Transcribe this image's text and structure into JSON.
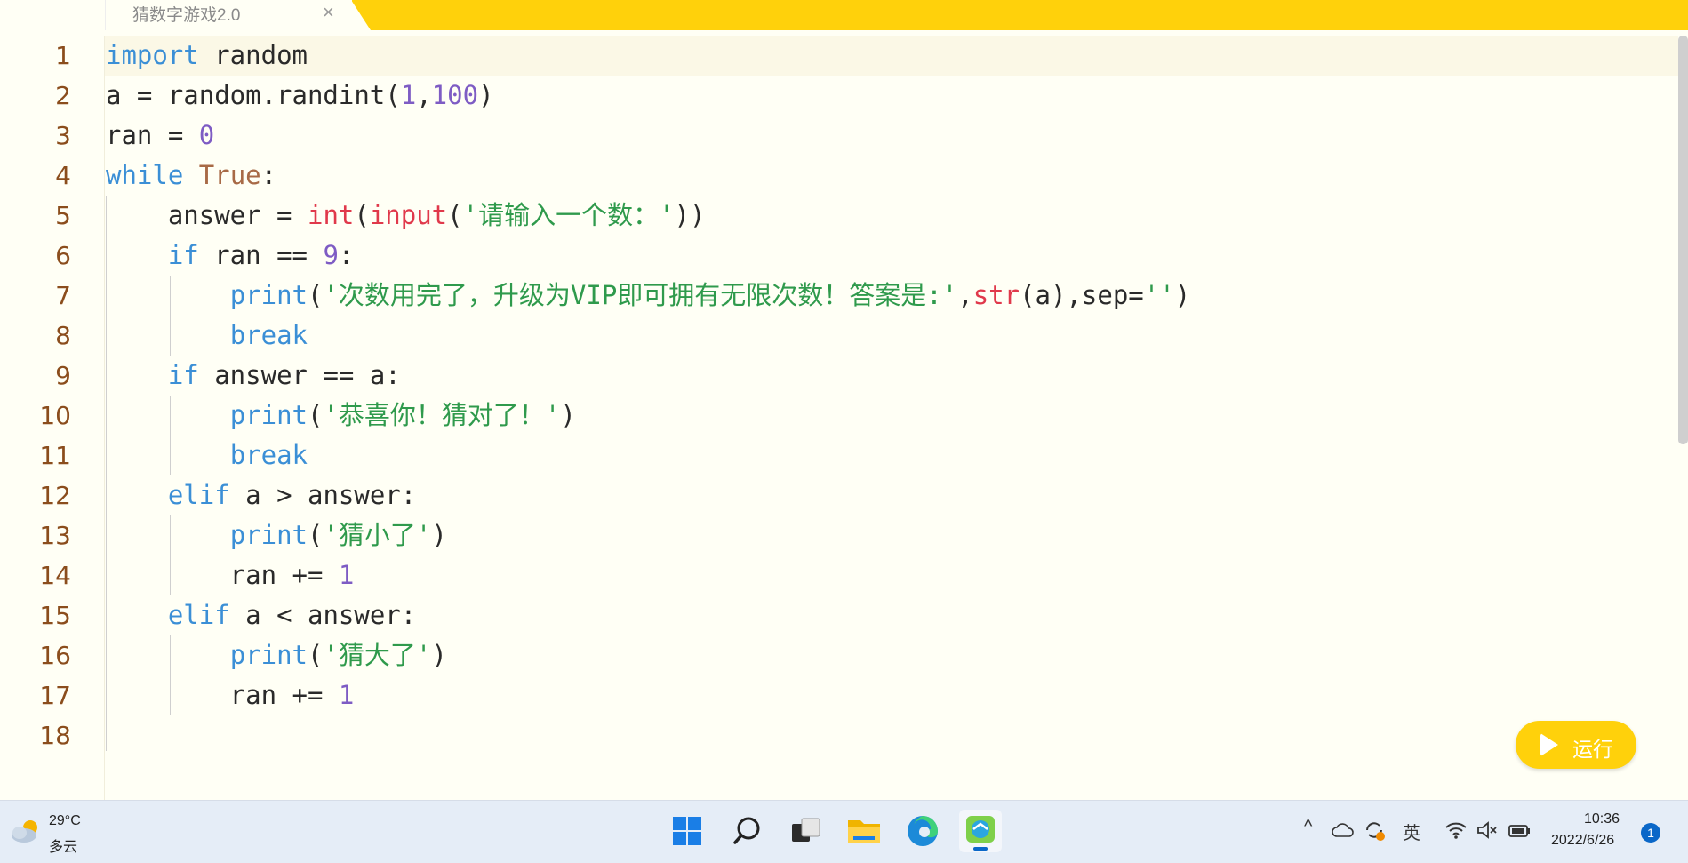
{
  "tab": {
    "title": "猜数字游戏2.0",
    "close_label": "×"
  },
  "editor": {
    "lines": [
      [
        [
          "kw",
          "import"
        ],
        [
          "",
          " random"
        ]
      ],
      [
        [
          "",
          "a = random.randint("
        ],
        [
          "num",
          "1"
        ],
        [
          "",
          ","
        ],
        [
          "num",
          "100"
        ],
        [
          "",
          ")"
        ]
      ],
      [
        [
          "",
          "ran = "
        ],
        [
          "num",
          "0"
        ]
      ],
      [
        [
          "kw",
          "while"
        ],
        [
          "",
          " "
        ],
        [
          "lit",
          "True"
        ],
        [
          "",
          ":"
        ]
      ],
      [
        [
          "",
          "    answer = "
        ],
        [
          "bi",
          "int"
        ],
        [
          "",
          "("
        ],
        [
          "bi",
          "input"
        ],
        [
          "",
          "("
        ],
        [
          "str",
          "'请输入一个数：'"
        ],
        [
          "",
          "))"
        ]
      ],
      [
        [
          "",
          "    "
        ],
        [
          "kw",
          "if"
        ],
        [
          "",
          " ran == "
        ],
        [
          "num",
          "9"
        ],
        [
          "",
          ":"
        ]
      ],
      [
        [
          "",
          "        "
        ],
        [
          "kw",
          "print"
        ],
        [
          "",
          "("
        ],
        [
          "str",
          "'次数用完了，升级为VIP即可拥有无限次数！答案是:'"
        ],
        [
          "",
          ","
        ],
        [
          "bi",
          "str"
        ],
        [
          "",
          "(a),sep="
        ],
        [
          "str",
          "''"
        ],
        [
          "",
          ")"
        ]
      ],
      [
        [
          "",
          "        "
        ],
        [
          "kw",
          "break"
        ]
      ],
      [
        [
          "",
          "    "
        ],
        [
          "kw",
          "if"
        ],
        [
          "",
          " answer == a:"
        ]
      ],
      [
        [
          "",
          "        "
        ],
        [
          "kw",
          "print"
        ],
        [
          "",
          "("
        ],
        [
          "str",
          "'恭喜你！猜对了！'"
        ],
        [
          "",
          ")"
        ]
      ],
      [
        [
          "",
          "        "
        ],
        [
          "kw",
          "break"
        ]
      ],
      [
        [
          "",
          "    "
        ],
        [
          "kw",
          "elif"
        ],
        [
          "",
          " a > answer:"
        ]
      ],
      [
        [
          "",
          "        "
        ],
        [
          "kw",
          "print"
        ],
        [
          "",
          "("
        ],
        [
          "str",
          "'猜小了'"
        ],
        [
          "",
          ")"
        ]
      ],
      [
        [
          "",
          "        ran += "
        ],
        [
          "num",
          "1"
        ]
      ],
      [
        [
          "",
          "    "
        ],
        [
          "kw",
          "elif"
        ],
        [
          "",
          " a < answer:"
        ]
      ],
      [
        [
          "",
          "        "
        ],
        [
          "kw",
          "print"
        ],
        [
          "",
          "("
        ],
        [
          "str",
          "'猜大了'"
        ],
        [
          "",
          ")"
        ]
      ],
      [
        [
          "",
          "        ran += "
        ],
        [
          "num",
          "1"
        ]
      ],
      [
        [
          "",
          ""
        ]
      ]
    ]
  },
  "run_button": {
    "label": "运行"
  },
  "taskbar": {
    "weather": {
      "temp": "29°C",
      "desc": "多云"
    },
    "apps": [
      "start-icon",
      "search-icon",
      "task-view-icon",
      "file-explorer-icon",
      "edge-icon",
      "active-app-icon"
    ],
    "tray": {
      "chevron": "^",
      "ime": "英"
    },
    "clock": {
      "time": "10:36",
      "date": "2022/6/26"
    },
    "notifications": "1"
  },
  "colors": {
    "accent": "#ffd10b",
    "keyword": "#3b8fd6",
    "string": "#2f9a4c",
    "number": "#7e5cc4",
    "builtin": "#e0394b",
    "line_number": "#8b4d1c"
  }
}
